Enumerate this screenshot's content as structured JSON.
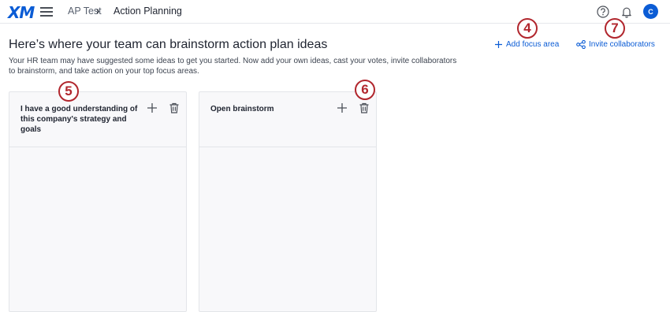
{
  "header": {
    "logo": "XM",
    "breadcrumb": [
      "AP Test",
      "Action Planning"
    ],
    "separator": "›",
    "avatar_initial": "C"
  },
  "main": {
    "title": "Here’s where your team can brainstorm action plan ideas",
    "description": "Your HR team may have suggested some ideas to get you started. Now add your own ideas, cast your votes, invite collaborators to brainstorm, and take action on your top focus areas.",
    "add_focus_area_label": "Add focus area",
    "invite_collaborators_label": "Invite collaborators"
  },
  "cards": [
    {
      "title": "I have a good understanding of this company's strategy and goals"
    },
    {
      "title": "Open brainstorm"
    }
  ],
  "callouts": [
    "4",
    "5",
    "6",
    "7"
  ],
  "colors": {
    "accent": "#0b5cd5",
    "callout": "#b1262d"
  },
  "icons": [
    "hamburger-icon",
    "help-icon",
    "bell-icon",
    "plus-icon",
    "share-icon",
    "trash-icon"
  ]
}
